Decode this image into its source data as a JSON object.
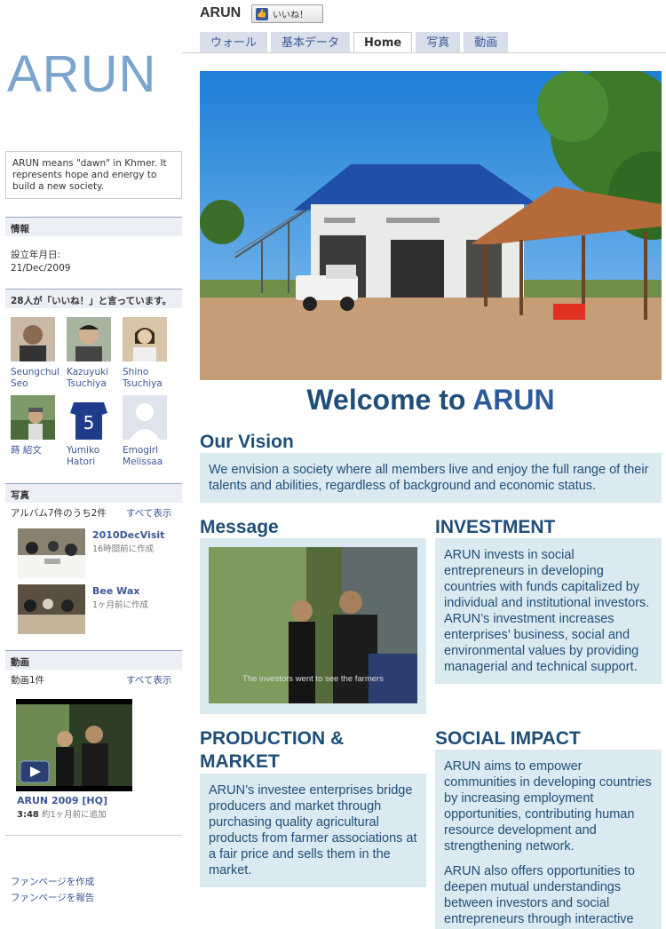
{
  "header": {
    "page_name": "ARUN",
    "like_button": "いいね！",
    "tabs": [
      "ウォール",
      "基本データ",
      "Home",
      "写真",
      "動画"
    ],
    "active_tab": "Home"
  },
  "sidebar": {
    "logo_text": "ARUN",
    "about": "ARUN means \"dawn\" in Khmer. It represents hope and energy to build a new society.",
    "info": {
      "heading": "情報",
      "founded_label": "設立年月日:",
      "founded_value": "21/Dec/2009"
    },
    "likes": {
      "heading": "28人が「いいね！」と言っています。",
      "fans": [
        {
          "name": "Seungchul Seo"
        },
        {
          "name": "Kazuyuki Tsuchiya"
        },
        {
          "name": "Shino Tsuchiya"
        },
        {
          "name": "蒔 紹文"
        },
        {
          "name": "Yumiko Hatori"
        },
        {
          "name": "Emogirl Melissaa"
        }
      ]
    },
    "photos": {
      "heading": "写真",
      "summary": "アルバム7件のうち2件",
      "see_all": "すべて表示",
      "albums": [
        {
          "title": "2010DecVisit",
          "time": "16時間前に作成"
        },
        {
          "title": "Bee Wax",
          "time": "1ヶ月前に作成"
        }
      ]
    },
    "videos": {
      "heading": "動画",
      "summary": "動画1件",
      "see_all": "すべて表示",
      "video_title": "ARUN 2009 [HQ]",
      "duration": "3:48",
      "added": "約1ヶ月前に追加"
    },
    "footer": [
      "ファンページを作成",
      "ファンページを報告"
    ]
  },
  "main": {
    "welcome_prefix": "Welcome to ",
    "welcome_brand": "ARUN",
    "vision_heading": "Our Vision",
    "vision_text": "We envision a society where all members live and enjoy the full range of their talents and abilities, regardless of background and economic status.",
    "message_heading": "Message",
    "video_caption": "The investors went to see the farmers",
    "investment_heading": "INVESTMENT",
    "investment_text": "ARUN invests in social entrepreneurs in developing countries with funds capitalized by individual and institutional investors. ARUN’s investment increases enterprises’ business, social and environmental values by providing managerial and technical support.",
    "production_heading": "PRODUCTION & MARKET",
    "production_text": "ARUN’s investee enterprises bridge producers and market through purchasing quality agricultural products from farmer associations at a fair price and sells them in the market.",
    "social_heading": "SOCIAL IMPACT",
    "social_text_1": "ARUN aims to empower communities in developing countries by increasing employment opportunities, contributing human resource development and strengthening network.",
    "social_text_2": "ARUN also offers opportunities to deepen mutual understandings between investors and social entrepreneurs through interactive"
  },
  "colors": {
    "brand_blue": "#1f4e79",
    "fb_blue": "#3b5998",
    "box_bg": "#dbeaf0",
    "logo": "#7ba4cf"
  }
}
